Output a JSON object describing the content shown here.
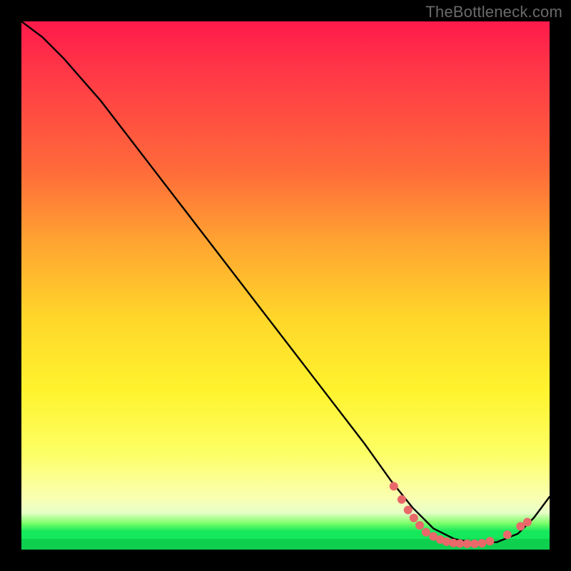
{
  "watermark": "TheBottleneck.com",
  "chart_data": {
    "type": "line",
    "title": "",
    "xlabel": "",
    "ylabel": "",
    "xlim": [
      0,
      100
    ],
    "ylim": [
      0,
      100
    ],
    "grid": false,
    "legend": false,
    "annotations": [],
    "series": [
      {
        "name": "curve",
        "stroke": "#000000",
        "x": [
          0,
          4,
          8,
          15,
          25,
          35,
          45,
          55,
          65,
          70,
          74,
          78,
          82,
          86,
          90,
          94,
          97,
          100
        ],
        "y": [
          100,
          97,
          93,
          85,
          72,
          59,
          46,
          33,
          20,
          13,
          8,
          4,
          2,
          1.2,
          1.4,
          3,
          6,
          10
        ]
      }
    ],
    "markers": {
      "name": "highlight-dots",
      "color": "#e9686a",
      "radius": 6,
      "points": [
        {
          "x": 70.5,
          "y": 12.0
        },
        {
          "x": 72.0,
          "y": 9.5
        },
        {
          "x": 73.2,
          "y": 7.5
        },
        {
          "x": 74.3,
          "y": 6.0
        },
        {
          "x": 75.4,
          "y": 4.6
        },
        {
          "x": 76.6,
          "y": 3.3
        },
        {
          "x": 78.0,
          "y": 2.5
        },
        {
          "x": 79.3,
          "y": 1.9
        },
        {
          "x": 80.5,
          "y": 1.5
        },
        {
          "x": 81.8,
          "y": 1.25
        },
        {
          "x": 83.0,
          "y": 1.15
        },
        {
          "x": 84.4,
          "y": 1.1
        },
        {
          "x": 85.8,
          "y": 1.1
        },
        {
          "x": 87.2,
          "y": 1.2
        },
        {
          "x": 88.7,
          "y": 1.6
        },
        {
          "x": 92.0,
          "y": 2.8
        },
        {
          "x": 94.5,
          "y": 4.4
        },
        {
          "x": 95.8,
          "y": 5.2
        }
      ]
    }
  }
}
